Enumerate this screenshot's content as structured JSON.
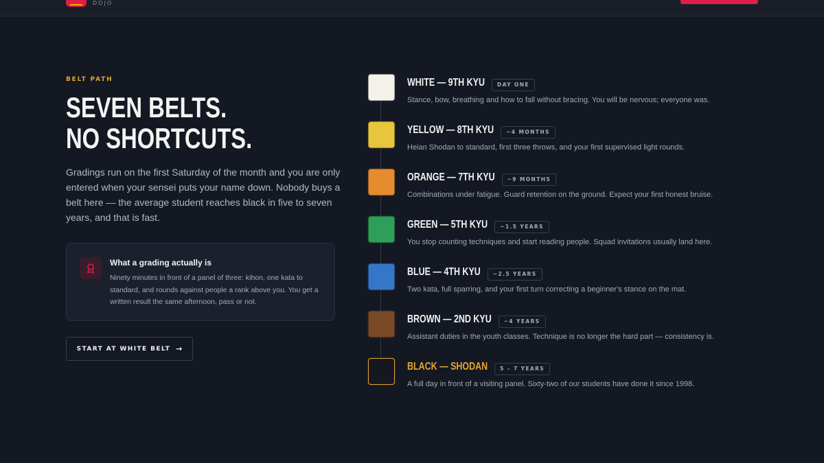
{
  "header": {
    "logo_word": "DOJO"
  },
  "section": {
    "eyebrow": "BELT PATH",
    "headline_line1": "SEVEN BELTS.",
    "headline_line2": "NO SHORTCUTS.",
    "intro": "Gradings run on the first Saturday of the month and you are only entered when your sensei puts your name down. Nobody buys a belt here — the average student reaches black in five to seven years, and that is fast."
  },
  "card": {
    "icon": "award-ribbon-icon",
    "title": "What a grading actually is",
    "body": "Ninety minutes in front of a panel of three: kihon, one kata to standard, and rounds against people a rank above you. You get a written result the same afternoon, pass or not."
  },
  "cta": {
    "label": "START AT WHITE BELT",
    "icon": "arrow-right-icon",
    "arrow": "→"
  },
  "colors": {
    "accent": "#e11d48",
    "eyebrow": "#e6a531",
    "black_belt_title": "#e6a531",
    "background": "#131822"
  },
  "belts": [
    {
      "name": "WHITE — 9TH KYU",
      "badge": "DAY ONE",
      "description": "Stance, bow, breathing and how to fall without bracing. You will be nervous; everyone was.",
      "color": "#f4f1ea"
    },
    {
      "name": "YELLOW — 8TH KYU",
      "badge": "~4 MONTHS",
      "description": "Heian Shodan to standard, first three throws, and your first supervised light rounds.",
      "color": "#e7c53c"
    },
    {
      "name": "ORANGE — 7TH KYU",
      "badge": "~9 MONTHS",
      "description": "Combinations under fatigue. Guard retention on the ground. Expect your first honest bruise.",
      "color": "#e68b2e"
    },
    {
      "name": "GREEN — 5TH KYU",
      "badge": "~1.5 YEARS",
      "description": "You stop counting techniques and start reading people. Squad invitations usually land here.",
      "color": "#2e9e5b"
    },
    {
      "name": "BLUE — 4TH KYU",
      "badge": "~2.5 YEARS",
      "description": "Two kata, full sparring, and your first turn correcting a beginner's stance on the mat.",
      "color": "#3576c9"
    },
    {
      "name": "BROWN — 2ND KYU",
      "badge": "~4 YEARS",
      "description": "Assistant duties in the youth classes. Technique is no longer the hard part — consistency is.",
      "color": "#7a4a27"
    },
    {
      "name": "BLACK — SHODAN",
      "badge": "5 – 7 YEARS",
      "description": "A full day in front of a visiting panel. Sixty-two of our students have done it since 1998.",
      "color": "#151821"
    }
  ]
}
